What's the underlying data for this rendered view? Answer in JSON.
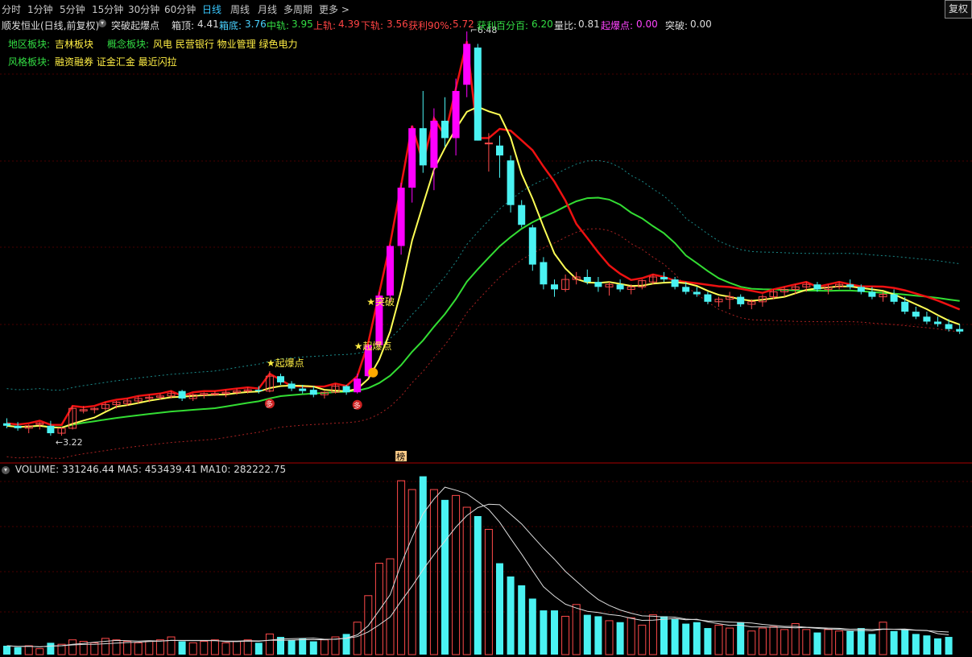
{
  "tabs": [
    {
      "label": "分时",
      "active": false
    },
    {
      "label": "1分钟",
      "active": false
    },
    {
      "label": "5分钟",
      "active": false
    },
    {
      "label": "15分钟",
      "active": false
    },
    {
      "label": "30分钟",
      "active": false
    },
    {
      "label": "60分钟",
      "active": false
    },
    {
      "label": "日线",
      "active": true
    },
    {
      "label": "周线",
      "active": false
    },
    {
      "label": "月线",
      "active": false
    },
    {
      "label": "多周期",
      "active": false
    },
    {
      "label": "更多",
      "active": false
    }
  ],
  "fuquan_button": "复权",
  "info": {
    "stock_title": "顺发恒业(日线,前复权)",
    "indicator_name": "突破起爆点",
    "box_top_label": "箱顶:",
    "box_top_value": "4.41",
    "box_bottom_label": "箱底:",
    "box_bottom_value": "3.76",
    "mid_label": "中轨:",
    "mid_value": "3.95",
    "upper_label": "上轨:",
    "upper_value": "4.39",
    "lower_label": "下轨:",
    "lower_value": "3.56",
    "profit90_label": "获利90%:",
    "profit90_value": "5.72",
    "profit100_label": "获利百分百:",
    "profit100_value": "6.20",
    "volratio_label": "量比:",
    "volratio_value": "0.81",
    "qibao_label": "起爆点:",
    "qibao_value": "0.00",
    "tupo_label": "突破:",
    "tupo_value": "0.00"
  },
  "sectors": {
    "region_label": "地区板块:",
    "region_value": "吉林板块",
    "concept_label": "概念板块:",
    "concept_value": "风电 民营银行 物业管理 绿色电力",
    "style_label": "风格板块:",
    "style_value": "融资融券 证金汇金 最近闪拉"
  },
  "annotations": {
    "high_price": "6.48",
    "low_price": "3.22",
    "qibao_1": "★起爆点",
    "qibao_2": "★起爆点",
    "tupo": "★突破",
    "bang": "榜",
    "duo": "多"
  },
  "volume": {
    "label": "VOLUME:",
    "value": "331246.44",
    "ma5_label": "MA5:",
    "ma5_value": "453439.41",
    "ma10_label": "MA10:",
    "ma10_value": "282222.75"
  },
  "colors": {
    "bg": "#000000",
    "up": "#ff4a4a",
    "down": "#4af2f2",
    "signal": "#ff00ff",
    "ma_green": "#33dd33",
    "ma_yellow": "#ffff55",
    "ma_red": "#ee1111"
  },
  "chart_data": {
    "type": "candlestick",
    "candles": [
      [
        3.32,
        3.36,
        3.28,
        3.3
      ],
      [
        3.3,
        3.33,
        3.26,
        3.28
      ],
      [
        3.28,
        3.31,
        3.24,
        3.3
      ],
      [
        3.31,
        3.33,
        3.27,
        3.32
      ],
      [
        3.3,
        3.34,
        3.22,
        3.24
      ],
      [
        3.24,
        3.29,
        3.22,
        3.28
      ],
      [
        3.28,
        3.46,
        3.27,
        3.44
      ],
      [
        3.42,
        3.46,
        3.4,
        3.43
      ],
      [
        3.43,
        3.45,
        3.4,
        3.44
      ],
      [
        3.44,
        3.49,
        3.42,
        3.47
      ],
      [
        3.47,
        3.5,
        3.44,
        3.49
      ],
      [
        3.48,
        3.52,
        3.46,
        3.5
      ],
      [
        3.5,
        3.54,
        3.48,
        3.52
      ],
      [
        3.52,
        3.55,
        3.49,
        3.53
      ],
      [
        3.53,
        3.56,
        3.51,
        3.54
      ],
      [
        3.54,
        3.58,
        3.52,
        3.56
      ],
      [
        3.58,
        3.59,
        3.5,
        3.52
      ],
      [
        3.52,
        3.56,
        3.5,
        3.55
      ],
      [
        3.55,
        3.57,
        3.52,
        3.56
      ],
      [
        3.56,
        3.58,
        3.54,
        3.56
      ],
      [
        3.56,
        3.59,
        3.53,
        3.57
      ],
      [
        3.57,
        3.6,
        3.55,
        3.58
      ],
      [
        3.58,
        3.61,
        3.56,
        3.59
      ],
      [
        3.59,
        3.62,
        3.56,
        3.58
      ],
      [
        3.58,
        3.74,
        3.57,
        3.7
      ],
      [
        3.7,
        3.72,
        3.63,
        3.65
      ],
      [
        3.64,
        3.66,
        3.58,
        3.6
      ],
      [
        3.6,
        3.63,
        3.56,
        3.58
      ],
      [
        3.59,
        3.62,
        3.53,
        3.55
      ],
      [
        3.55,
        3.58,
        3.52,
        3.57
      ],
      [
        3.57,
        3.64,
        3.56,
        3.62
      ],
      [
        3.62,
        3.63,
        3.55,
        3.57
      ],
      [
        3.57,
        3.72,
        3.56,
        3.68
      ],
      [
        3.7,
        3.96,
        3.69,
        3.95
      ],
      [
        3.95,
        4.38,
        3.93,
        4.35
      ],
      [
        4.35,
        4.76,
        4.3,
        4.75
      ],
      [
        4.75,
        5.26,
        4.68,
        5.22
      ],
      [
        5.22,
        5.72,
        5.1,
        5.7
      ],
      [
        5.7,
        6.0,
        5.34,
        5.4
      ],
      [
        5.38,
        5.86,
        5.2,
        5.76
      ],
      [
        5.76,
        5.95,
        5.55,
        5.62
      ],
      [
        5.62,
        6.1,
        5.48,
        6.0
      ],
      [
        6.05,
        6.48,
        5.95,
        6.38
      ],
      [
        6.35,
        6.38,
        5.6,
        5.6
      ],
      [
        5.58,
        5.66,
        5.35,
        5.58
      ],
      [
        5.56,
        5.64,
        5.3,
        5.48
      ],
      [
        5.44,
        5.48,
        5.02,
        5.08
      ],
      [
        5.08,
        5.12,
        4.9,
        4.92
      ],
      [
        4.9,
        4.92,
        4.55,
        4.6
      ],
      [
        4.62,
        4.66,
        4.4,
        4.44
      ],
      [
        4.44,
        4.48,
        4.34,
        4.4
      ],
      [
        4.4,
        4.52,
        4.38,
        4.48
      ],
      [
        4.48,
        4.54,
        4.44,
        4.5
      ],
      [
        4.5,
        4.56,
        4.44,
        4.46
      ],
      [
        4.46,
        4.5,
        4.38,
        4.42
      ],
      [
        4.42,
        4.46,
        4.35,
        4.44
      ],
      [
        4.44,
        4.48,
        4.38,
        4.4
      ],
      [
        4.4,
        4.44,
        4.36,
        4.42
      ],
      [
        4.42,
        4.48,
        4.4,
        4.47
      ],
      [
        4.46,
        4.52,
        4.44,
        4.5
      ],
      [
        4.5,
        4.54,
        4.46,
        4.48
      ],
      [
        4.48,
        4.5,
        4.4,
        4.42
      ],
      [
        4.42,
        4.46,
        4.36,
        4.38
      ],
      [
        4.38,
        4.42,
        4.34,
        4.36
      ],
      [
        4.36,
        4.38,
        4.28,
        4.3
      ],
      [
        4.3,
        4.34,
        4.26,
        4.32
      ],
      [
        4.32,
        4.38,
        4.24,
        4.34
      ],
      [
        4.34,
        4.36,
        4.26,
        4.28
      ],
      [
        4.28,
        4.32,
        4.24,
        4.3
      ],
      [
        4.3,
        4.36,
        4.26,
        4.34
      ],
      [
        4.34,
        4.4,
        4.32,
        4.38
      ],
      [
        4.38,
        4.42,
        4.34,
        4.4
      ],
      [
        4.4,
        4.44,
        4.36,
        4.42
      ],
      [
        4.42,
        4.46,
        4.38,
        4.44
      ],
      [
        4.44,
        4.46,
        4.38,
        4.4
      ],
      [
        4.4,
        4.44,
        4.36,
        4.42
      ],
      [
        4.42,
        4.46,
        4.4,
        4.44
      ],
      [
        4.44,
        4.48,
        4.4,
        4.42
      ],
      [
        4.42,
        4.44,
        4.36,
        4.38
      ],
      [
        4.38,
        4.42,
        4.32,
        4.34
      ],
      [
        4.34,
        4.38,
        4.3,
        4.36
      ],
      [
        4.36,
        4.4,
        4.28,
        4.3
      ],
      [
        4.3,
        4.34,
        4.2,
        4.22
      ],
      [
        4.22,
        4.26,
        4.16,
        4.18
      ],
      [
        4.18,
        4.22,
        4.12,
        4.14
      ],
      [
        4.14,
        4.18,
        4.1,
        4.12
      ],
      [
        4.12,
        4.16,
        4.06,
        4.08
      ],
      [
        4.08,
        4.12,
        4.04,
        4.06
      ]
    ],
    "volumes": [
      6,
      5,
      6,
      4,
      8,
      7,
      10,
      9,
      8,
      11,
      10,
      9,
      8,
      9,
      10,
      12,
      9,
      8,
      9,
      10,
      8,
      9,
      10,
      8,
      14,
      12,
      10,
      11,
      9,
      10,
      12,
      14,
      22,
      40,
      62,
      65,
      118,
      112,
      121,
      112,
      105,
      108,
      100,
      94,
      85,
      62,
      53,
      47,
      38,
      30,
      30,
      26,
      34,
      27,
      26,
      23,
      22,
      25,
      20,
      27,
      26,
      24,
      21,
      22,
      18,
      20,
      18,
      22,
      16,
      18,
      19,
      17,
      21,
      17,
      15,
      17,
      16,
      16,
      18,
      14,
      22,
      16,
      17,
      14,
      13,
      11,
      12
    ]
  }
}
